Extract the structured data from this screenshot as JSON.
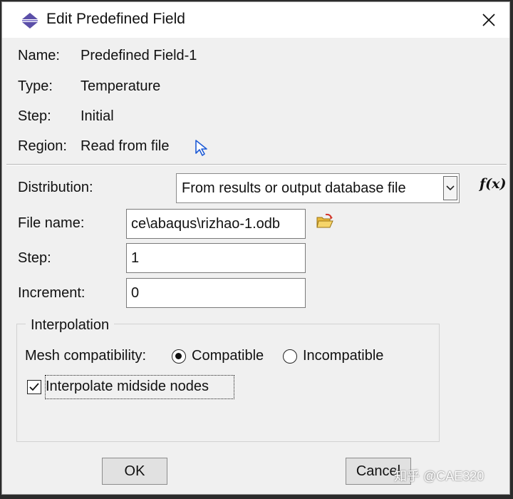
{
  "window": {
    "title": "Edit Predefined Field"
  },
  "info": {
    "name_label": "Name:",
    "name_value": "Predefined Field-1",
    "type_label": "Type:",
    "type_value": "Temperature",
    "step_label": "Step:",
    "step_value": "Initial",
    "region_label": "Region:",
    "region_value": "Read from file"
  },
  "distribution": {
    "label": "Distribution:",
    "selected": "From results or output database file",
    "function_button": "f(x)"
  },
  "file": {
    "label": "File name:",
    "value": "ce\\abaqus\\rizhao-1.odb"
  },
  "step": {
    "label": "Step:",
    "value": "1"
  },
  "increment": {
    "label": "Increment:",
    "value": "0"
  },
  "interpolation": {
    "title": "Interpolation",
    "mesh_label": "Mesh compatibility:",
    "compatible_label": "Compatible",
    "incompatible_label": "Incompatible",
    "selected": "Compatible",
    "midside_label": "Interpolate midside nodes",
    "midside_checked": true
  },
  "buttons": {
    "ok": "OK",
    "cancel": "Cancel"
  },
  "watermark": "知乎 @CAE320",
  "icons": [
    "app-icon",
    "close-icon",
    "region-pick-icon",
    "chevron-down-icon",
    "open-folder-icon"
  ]
}
